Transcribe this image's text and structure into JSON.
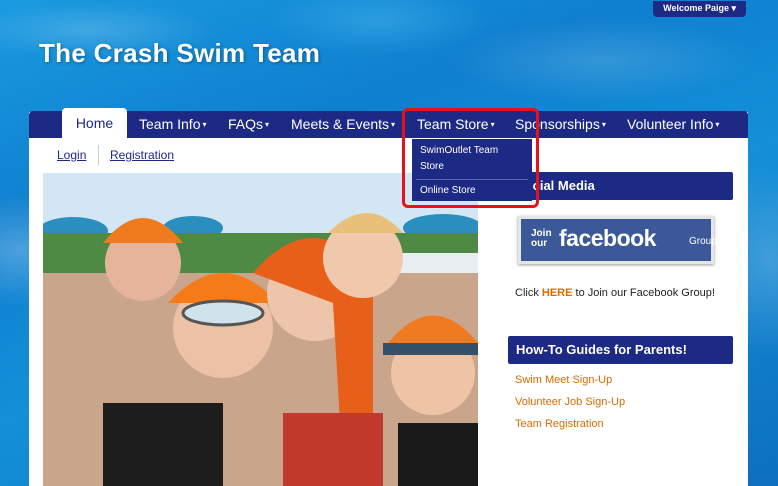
{
  "header": {
    "site_title": "The Crash Swim Team",
    "welcome_label": "Welcome Paige ▾"
  },
  "nav": {
    "home": "Home",
    "team_info": "Team Info",
    "faqs": "FAQs",
    "meets_events": "Meets & Events",
    "team_store": "Team Store",
    "sponsorships": "Sponsorships",
    "volunteer_info": "Volunteer Info",
    "caret": "▾"
  },
  "dropdown": {
    "item_1_line_1": "SwimOutlet Team",
    "item_1_line_2": "Store",
    "item_2": "Online Store"
  },
  "subnav": {
    "login": "Login",
    "registration": "Registration"
  },
  "sidebar": {
    "social_header": "Social Media",
    "fb_join": "Join our",
    "fb_word": "facebook",
    "fb_group": "Group",
    "fb_text_before": "Click ",
    "fb_text_link": "HERE",
    "fb_text_after": " to Join our Facebook Group!",
    "guides_header": "How-To Guides for Parents!",
    "guides": [
      "Swim Meet Sign-Up",
      "Volunteer Job Sign-Up",
      "Team Registration"
    ]
  },
  "colors": {
    "nav_bg": "#1c2a86",
    "link_orange": "#d96b00",
    "highlight_red": "#e8101a"
  }
}
